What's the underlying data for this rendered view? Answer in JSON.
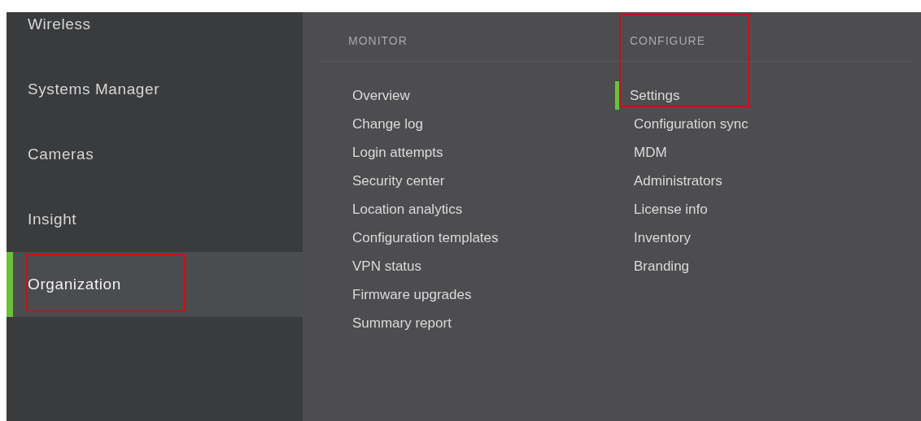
{
  "sidebar": {
    "items": [
      {
        "label": "Wireless",
        "selected": false,
        "annotated": false
      },
      {
        "label": "Systems Manager",
        "selected": false,
        "annotated": false
      },
      {
        "label": "Cameras",
        "selected": false,
        "annotated": false
      },
      {
        "label": "Insight",
        "selected": false,
        "annotated": false
      },
      {
        "label": "Organization",
        "selected": true,
        "annotated": true
      }
    ]
  },
  "menu": {
    "columns": [
      {
        "header": "MONITOR",
        "annotated": false,
        "items": [
          {
            "label": "Overview",
            "selected": false
          },
          {
            "label": "Change log",
            "selected": false
          },
          {
            "label": "Login attempts",
            "selected": false
          },
          {
            "label": "Security center",
            "selected": false
          },
          {
            "label": "Location analytics",
            "selected": false
          },
          {
            "label": "Configuration templates",
            "selected": false
          },
          {
            "label": "VPN status",
            "selected": false
          },
          {
            "label": "Firmware upgrades",
            "selected": false
          },
          {
            "label": "Summary report",
            "selected": false
          }
        ]
      },
      {
        "header": "CONFIGURE",
        "annotated": true,
        "items": [
          {
            "label": "Settings",
            "selected": true
          },
          {
            "label": "Configuration sync",
            "selected": false
          },
          {
            "label": "MDM",
            "selected": false
          },
          {
            "label": "Administrators",
            "selected": false
          },
          {
            "label": "License info",
            "selected": false
          },
          {
            "label": "Inventory",
            "selected": false
          },
          {
            "label": "Branding",
            "selected": false
          }
        ]
      }
    ]
  }
}
